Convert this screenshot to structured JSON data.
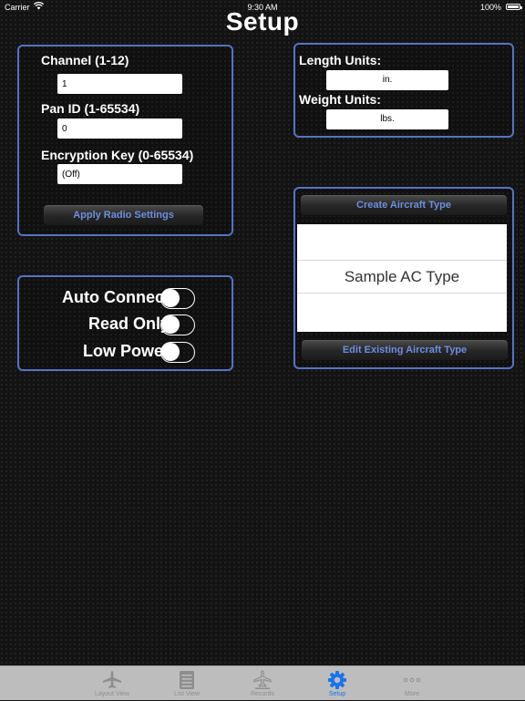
{
  "status_bar": {
    "carrier": "Carrier",
    "time": "9:30 AM",
    "battery": "100%"
  },
  "page_title": "Setup",
  "radio": {
    "channel_label": "Channel (1-12)",
    "channel_value": "1",
    "pan_id_label": "Pan ID (1-65534)",
    "pan_id_value": "0",
    "encryption_label": "Encryption Key (0-65534)",
    "encryption_value": "(Off)",
    "apply_button": "Apply Radio Settings"
  },
  "toggles": [
    {
      "label": "Auto Connect",
      "on": false
    },
    {
      "label": "Read Only",
      "on": false
    },
    {
      "label": "Low Power",
      "on": false
    }
  ],
  "units": {
    "length_label": "Length Units:",
    "length_value": "in.",
    "weight_label": "Weight Units:",
    "weight_value": "lbs."
  },
  "aircraft": {
    "create_button": "Create Aircraft Type",
    "types": [
      "",
      "Sample AC Type",
      ""
    ],
    "edit_button": "Edit Existing Aircraft Type"
  },
  "tabs": [
    {
      "label": "Layout View",
      "icon": "airplane-icon",
      "active": false
    },
    {
      "label": "List View",
      "icon": "list-icon",
      "active": false
    },
    {
      "label": "Records",
      "icon": "records-icon",
      "active": false
    },
    {
      "label": "Setup",
      "icon": "gear-icon",
      "active": true
    },
    {
      "label": "More",
      "icon": "more-icon",
      "active": false
    }
  ],
  "colors": {
    "accent": "#1a73e8",
    "panel_border": "#5573c4",
    "button_text": "#6d8fe0"
  }
}
